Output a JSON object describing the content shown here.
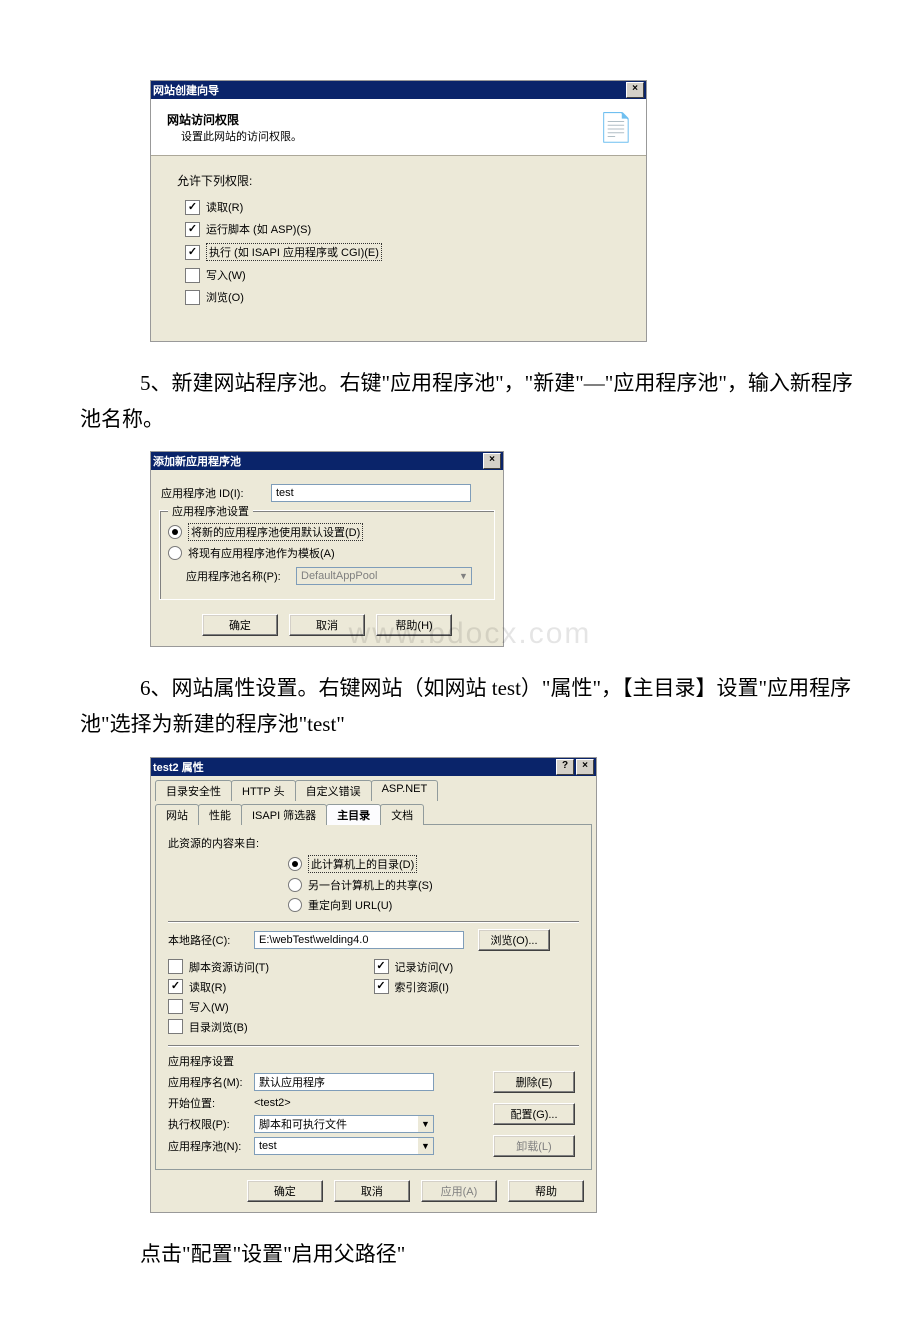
{
  "wizard1": {
    "title": "网站创建向导",
    "header_title": "网站访问权限",
    "header_sub": "设置此网站的访问权限。",
    "allow_label": "允许下列权限:",
    "opts": {
      "read": "读取(R)",
      "scripts": "运行脚本 (如 ASP)(S)",
      "execute": "执行 (如 ISAPI 应用程序或 CGI)(E)",
      "write": "写入(W)",
      "browse": "浏览(O)"
    }
  },
  "para5": "5、新建网站程序池。右键\"应用程序池\"，\"新建\"—\"应用程序池\"，输入新程序池名称。",
  "dlg2": {
    "title": "添加新应用程序池",
    "id_label": "应用程序池 ID(I):",
    "id_value": "test",
    "group_title": "应用程序池设置",
    "opt_default": "将新的应用程序池使用默认设置(D)",
    "opt_template": "将现有应用程序池作为模板(A)",
    "pool_name_label": "应用程序池名称(P):",
    "pool_name_value": "DefaultAppPool",
    "btn_ok": "确定",
    "btn_cancel": "取消",
    "btn_help": "帮助(H)"
  },
  "para6": "6、网站属性设置。右键网站（如网站 test）\"属性\"，【主目录】设置\"应用程序池\"选择为新建的程序池\"test\"",
  "watermark": "www.bdocx.com",
  "dlg3": {
    "title": "test2 属性",
    "tabs_row1": [
      "目录安全性",
      "HTTP 头",
      "自定义错误",
      "ASP.NET"
    ],
    "tabs_row2": [
      "网站",
      "性能",
      "ISAPI 筛选器",
      "主目录",
      "文档"
    ],
    "source_label": "此资源的内容来自:",
    "src": {
      "local": "此计算机上的目录(D)",
      "share": "另一台计算机上的共享(S)",
      "redirect": "重定向到 URL(U)"
    },
    "local_path_label": "本地路径(C):",
    "local_path_value": "E:\\webTest\\welding4.0",
    "browse_btn": "浏览(O)...",
    "flags": {
      "script_src": "脚本资源访问(T)",
      "read": "读取(R)",
      "write": "写入(W)",
      "dir_browse": "目录浏览(B)",
      "log": "记录访问(V)",
      "index": "索引资源(I)"
    },
    "app_section": "应用程序设置",
    "app_name_label": "应用程序名(M):",
    "app_name_value": "默认应用程序",
    "start_label": "开始位置:",
    "start_value": "<test2>",
    "exec_perm_label": "执行权限(P):",
    "exec_perm_value": "脚本和可执行文件",
    "pool_label": "应用程序池(N):",
    "pool_value": "test",
    "btn_remove": "删除(E)",
    "btn_config": "配置(G)...",
    "btn_unload": "卸载(L)",
    "btn_ok": "确定",
    "btn_cancel": "取消",
    "btn_apply": "应用(A)",
    "btn_help": "帮助"
  },
  "para7": "点击\"配置\"设置\"启用父路径\""
}
